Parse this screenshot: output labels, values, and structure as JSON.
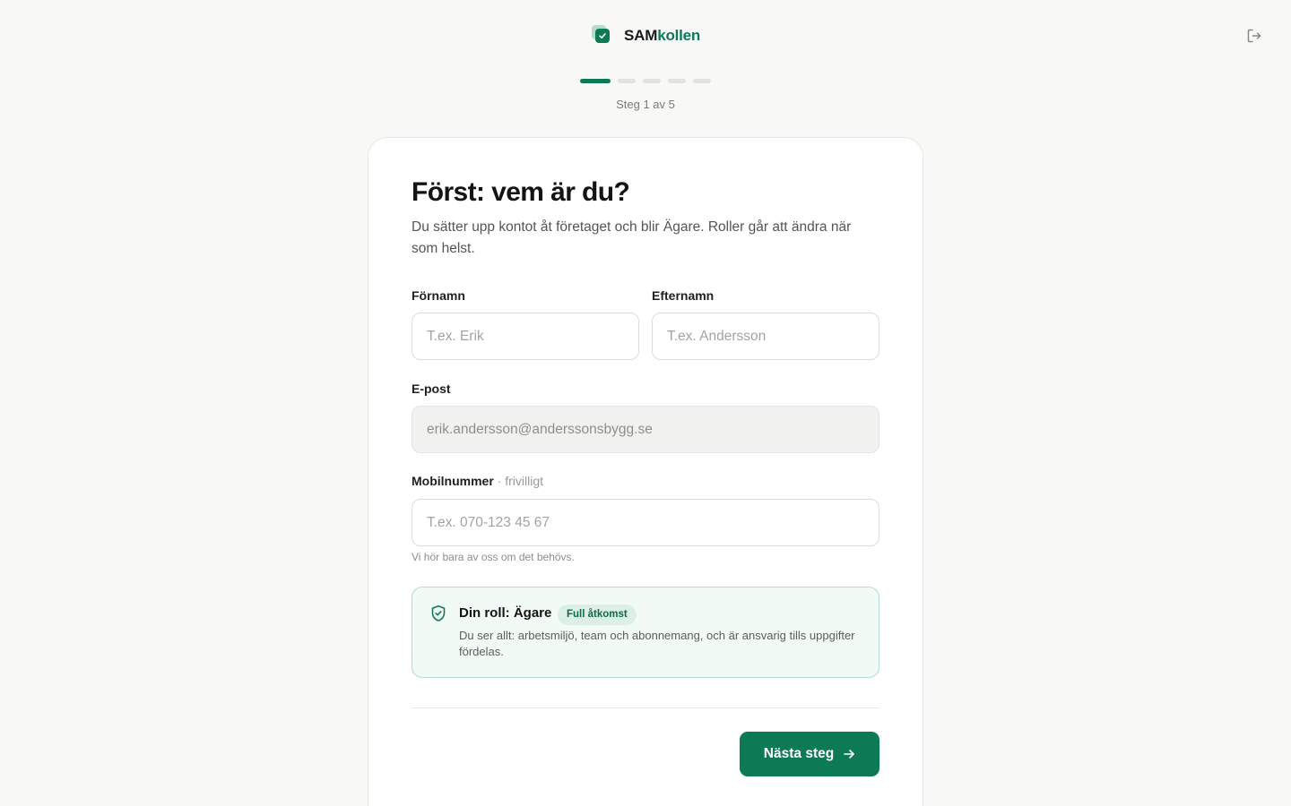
{
  "brand": {
    "name_part1": "SAM",
    "name_part2": "kollen",
    "accent_color": "#0e7a55"
  },
  "header": {
    "logout_icon": "logout-icon"
  },
  "progress": {
    "current_step": 1,
    "total_steps": 5,
    "label": "Steg 1 av 5"
  },
  "form": {
    "title": "Först: vem är du?",
    "lead": "Du sätter upp kontot åt företaget och blir Ägare. Roller går att ändra när som helst.",
    "first_name": {
      "label": "Förnamn",
      "placeholder": "T.ex. Erik",
      "value": ""
    },
    "last_name": {
      "label": "Efternamn",
      "placeholder": "T.ex. Andersson",
      "value": ""
    },
    "email": {
      "label": "E-post",
      "value": "erik.andersson@anderssonsbygg.se"
    },
    "phone": {
      "label": "Mobilnummer",
      "optional_hint": "· frivilligt",
      "placeholder": "T.ex. 070-123 45 67",
      "value": "",
      "help": "Vi hör bara av oss om det behövs."
    },
    "role": {
      "title": "Din roll: Ägare",
      "badge": "Full åtkomst",
      "description": "Du ser allt: arbetsmiljö, team och abonnemang, och är ansvarig tills uppgifter fördelas.",
      "icon": "shield-check-icon"
    },
    "next_button": {
      "label": "Nästa steg",
      "icon": "arrow-right-icon"
    }
  }
}
